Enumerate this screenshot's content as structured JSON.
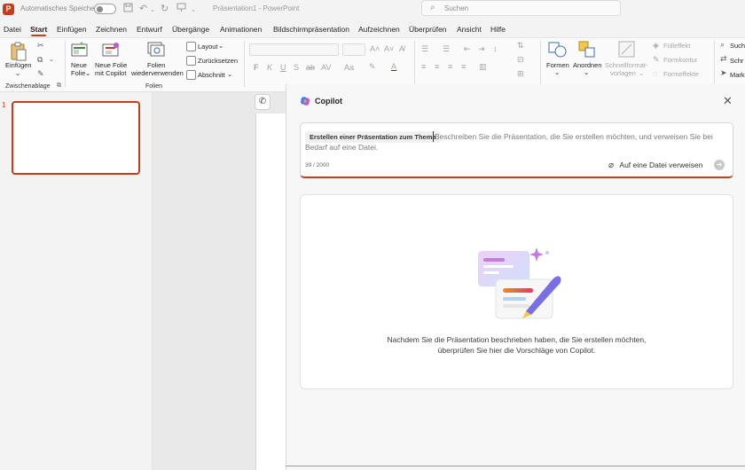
{
  "titlebar": {
    "app_logo": "P",
    "autosave_label": "Automatisches Speichern",
    "autosave_state": "off",
    "document_title": "Präsentation1 - PowerPoint",
    "search_placeholder": "Suchen",
    "icons": [
      "save-icon",
      "undo-icon",
      "redo-icon",
      "presenter-icon"
    ]
  },
  "menu": {
    "tabs": [
      "Datei",
      "Start",
      "Einfügen",
      "Zeichnen",
      "Entwurf",
      "Übergänge",
      "Animationen",
      "Bildschirmpräsentation",
      "Aufzeichnen",
      "Überprüfen",
      "Ansicht",
      "Hilfe"
    ],
    "active_tab": "Start"
  },
  "ribbon": {
    "clipboard": {
      "paste_label": "Einfügen",
      "group_label": "Zwischenablage"
    },
    "slides": {
      "new_slide_line1": "Neue",
      "new_slide_line2": "Folie",
      "new_slide_copilot_line1": "Neue Folie",
      "new_slide_copilot_line2": "mit Copilot",
      "reuse_line1": "Folien",
      "reuse_line2": "wiederverwenden",
      "layout_label": "Layout",
      "reset_label": "Zurücksetzen",
      "section_label": "Abschnitt",
      "group_label": "Folien"
    },
    "font": {
      "bold": "F",
      "italic": "K",
      "underline": "U",
      "strike": "S",
      "shadow": "ab",
      "spacing": "AV",
      "case": "Aa"
    },
    "drawing": {
      "shapes_label": "Formen",
      "arrange_label": "Anordnen",
      "quickstyles_line1": "Schnellformat-",
      "quickstyles_line2": "vorlagen",
      "fill_label": "Fülleffekt",
      "outline_label": "Formkontur",
      "effects_label": "Formeffekte"
    },
    "editing": {
      "search_label": "Such",
      "replace_label": "Schr",
      "select_label": "Mark"
    }
  },
  "thumbnails": {
    "slide_number": "1"
  },
  "copilot": {
    "title": "Copilot",
    "chip_label": "Erstellen einer Präsentation zum Thema",
    "prompt_line1": "Beschreiben Sie die Präsentation, die Sie erstellen möchten, und verweisen Sie bei",
    "prompt_line2": "Bedarf auf eine Datei.",
    "char_counter": "39 / 2000",
    "attach_label": "Auf eine Datei verweisen",
    "hint_line1": "Nachdem Sie die Präsentation beschrieben haben, die Sie erstellen möchten,",
    "hint_line2": "überprüfen Sie hier die Vorschläge von Copilot."
  },
  "colors": {
    "accent": "#c43e1c",
    "copilot_purple": "#b75bd6",
    "copilot_blue": "#3b82f6"
  }
}
